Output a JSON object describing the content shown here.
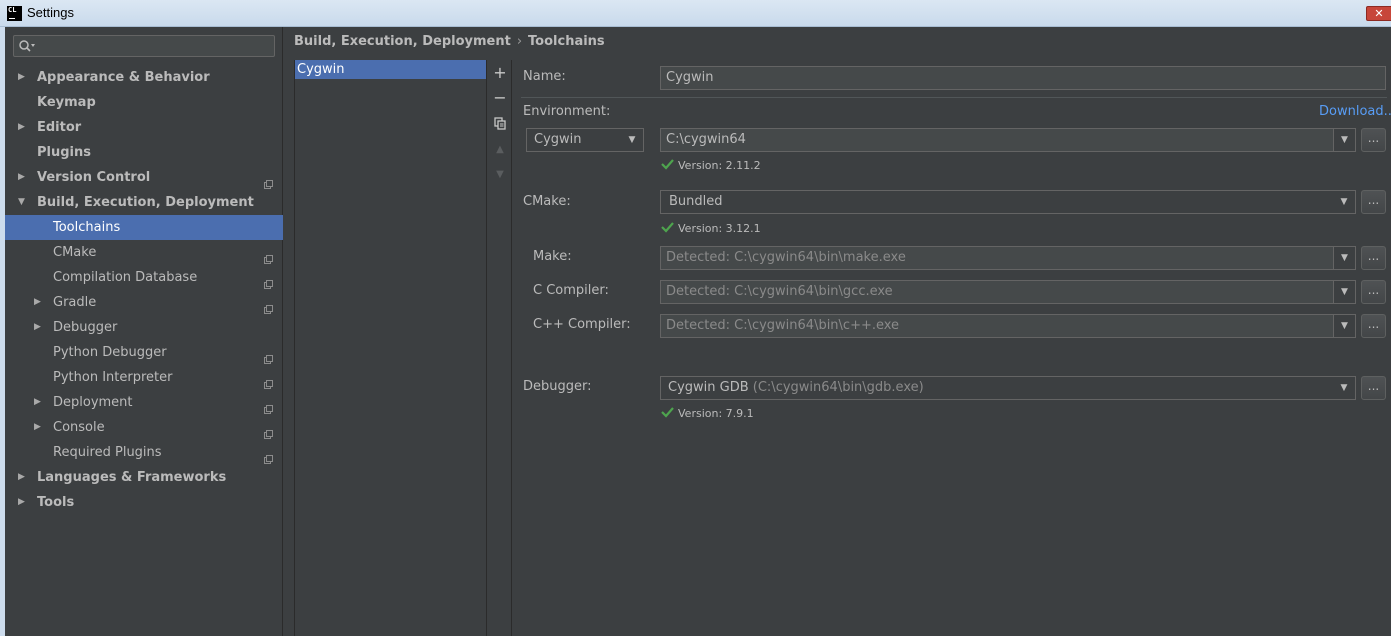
{
  "window": {
    "title": "Settings",
    "logo_text": "CL",
    "close_glyph": "✕"
  },
  "search": {
    "placeholder": ""
  },
  "sidebar": {
    "items": [
      {
        "label": "Appearance & Behavior",
        "bold": true,
        "expandable": true,
        "expanded": false,
        "level": 0
      },
      {
        "label": "Keymap",
        "bold": true,
        "expandable": false,
        "level": 0
      },
      {
        "label": "Editor",
        "bold": true,
        "expandable": true,
        "expanded": false,
        "level": 0
      },
      {
        "label": "Plugins",
        "bold": true,
        "expandable": false,
        "level": 0
      },
      {
        "label": "Version Control",
        "bold": true,
        "expandable": true,
        "expanded": false,
        "level": 0,
        "project_icon": true
      },
      {
        "label": "Build, Execution, Deployment",
        "bold": true,
        "expandable": true,
        "expanded": true,
        "level": 0
      },
      {
        "label": "Toolchains",
        "level": 1,
        "selected": true
      },
      {
        "label": "CMake",
        "level": 1,
        "project_icon": true
      },
      {
        "label": "Compilation Database",
        "level": 1,
        "project_icon": true
      },
      {
        "label": "Gradle",
        "level": 1,
        "expandable": true,
        "expanded": false,
        "project_icon": true
      },
      {
        "label": "Debugger",
        "level": 1,
        "expandable": true,
        "expanded": false
      },
      {
        "label": "Python Debugger",
        "level": 1,
        "project_icon": true
      },
      {
        "label": "Python Interpreter",
        "level": 1,
        "project_icon": true
      },
      {
        "label": "Deployment",
        "level": 1,
        "expandable": true,
        "expanded": false,
        "project_icon": true
      },
      {
        "label": "Console",
        "level": 1,
        "expandable": true,
        "expanded": false,
        "project_icon": true
      },
      {
        "label": "Required Plugins",
        "level": 1,
        "project_icon": true
      },
      {
        "label": "Languages & Frameworks",
        "bold": true,
        "expandable": true,
        "expanded": false,
        "level": 0
      },
      {
        "label": "Tools",
        "bold": true,
        "expandable": true,
        "expanded": false,
        "level": 0
      }
    ]
  },
  "breadcrumb": {
    "parent": "Build, Execution, Deployment",
    "separator": "›",
    "current": "Toolchains"
  },
  "toolchains": {
    "items": [
      "Cygwin"
    ],
    "selected": 0,
    "toolbar": {
      "add": "+",
      "remove": "−",
      "copy": "⧉",
      "up": "▲",
      "down": "▼"
    }
  },
  "form": {
    "name_label": "Name:",
    "name_value": "Cygwin",
    "environment_label": "Environment:",
    "download_link": "Download...",
    "environment_type": "Cygwin",
    "environment_path": "C:\\cygwin64",
    "environment_version": "Version: 2.11.2",
    "cmake_label": "CMake:",
    "cmake_value": "Bundled",
    "cmake_version": "Version: 3.12.1",
    "make_label": "Make:",
    "make_value": "Detected: C:\\cygwin64\\bin\\make.exe",
    "c_compiler_label": "C Compiler:",
    "c_compiler_value": "Detected: C:\\cygwin64\\bin\\gcc.exe",
    "cpp_compiler_label": "C++ Compiler:",
    "cpp_compiler_value": "Detected: C:\\cygwin64\\bin\\c++.exe",
    "debugger_label": "Debugger:",
    "debugger_name": "Cygwin GDB",
    "debugger_path": "(C:\\cygwin64\\bin\\gdb.exe)",
    "debugger_version": "Version: 7.9.1",
    "browse_label": "...",
    "dropdown_caret": "▼"
  },
  "colors": {
    "accent": "#4b6eaf",
    "link": "#589df6",
    "check": "#4ea44e",
    "background": "#3c3f41"
  }
}
